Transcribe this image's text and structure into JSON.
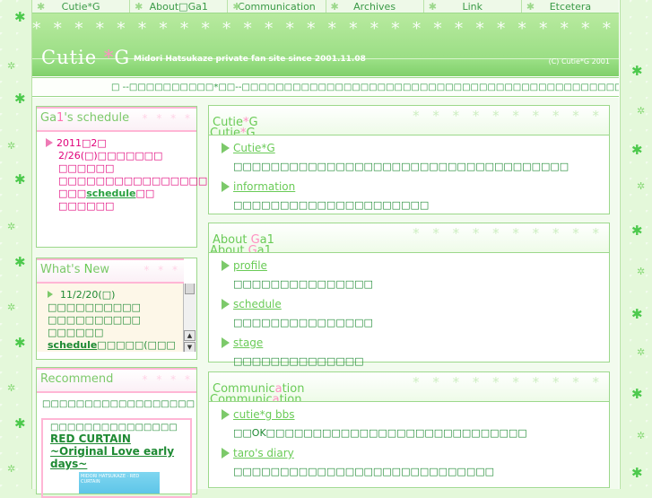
{
  "nav": {
    "items": [
      "Cutie*G",
      "About□Ga1",
      "Communication",
      "Archives",
      "Link",
      "Etcetera"
    ]
  },
  "banner": {
    "logo_main": "Cutie ",
    "logo_star": "*",
    "logo_end": "G",
    "tagline": "Midori Hatsukaze private fan site since 2001.11.08",
    "copyright": "(C) Cutie*G 2001",
    "stars": "* * * * * * * * * * * * * * * * * * * * * * * * * * * * * * * * * * * * * * * * *"
  },
  "marquee": {
    "text": "□ --□□□□□□□□□□*□□--□□□□□□□□□□□□□□□□□□□□□□□□□□□□□□□□□□□□□□□□□□□□□□□□□□□□□□□□□□□□□□□□□□**"
  },
  "schedule": {
    "title_pre": "Ga",
    "title_mid": "1",
    "title_post": "'s schedule",
    "date": "2011□2□",
    "line1": "2/26(□)□□□□□□□",
    "line2": "□□□□□□",
    "line3": "□□□□□□□□□□□□□□□□□□□",
    "line4_pre": "□□□",
    "line4_link": "schedule",
    "line4_post": "□□",
    "line5": "□□□□□□"
  },
  "whats_new": {
    "title_pre": "What's ",
    "title_n": "N",
    "title_post": "ew",
    "date": "11/2/20(□)",
    "line1": "□□□□□□□□□□",
    "line2": "□□□□□□□□□□",
    "line3": "□□□□□□",
    "line4_link": "schedule",
    "line4_post": "□□□□□(□□□"
  },
  "recommend": {
    "title_pre": "Re",
    "title_c": "c",
    "title_post": "ommend",
    "intro": "□□□□□□□□□□□□□□□□□□",
    "card_jp": "□□□□□□□□□□□□□□□",
    "card_link": "RED CURTAIN ~Original Love early days~",
    "album_caption": "MIDORI HATSUKAZE · RED CURTAIN"
  },
  "panel_cutie": {
    "title1_pre": "Cutie",
    "title1_star": "*",
    "title1_post": "G",
    "title2_pre": "Cutie",
    "title2_star": "*",
    "title2_post": "G",
    "item1": "Cutie*G",
    "desc1": "□□□□□□□□□□□□□□□□□□□□□□□□□□□□□□□□□□□□",
    "item2": "information",
    "desc2": "□□□□□□□□□□□□□□□□□□□□□"
  },
  "panel_about": {
    "title1_pre": "About ",
    "title1_pink": "G",
    "title1_post": "a1",
    "title2_pre": "About ",
    "title2_pink": "G",
    "title2_post": "a1",
    "item1": "profile",
    "desc1": "□□□□□□□□□□□□□□□",
    "item2": "schedule",
    "desc2": "□□□□□□□□□□□□□□□",
    "item3": "stage",
    "desc3": "□□□□□□□□□□□□□□"
  },
  "panel_comm": {
    "title1_pre": "Communic",
    "title1_pink": "a",
    "title1_post": "tion",
    "title2_pre": "Communic",
    "title2_pink": "a",
    "title2_post": "tion",
    "item1": "cutie*g bbs",
    "desc1": "□□OK□□□□□□□□□□□□□□□□□□□□□□□□□□□□",
    "item2": "taro's diary",
    "desc2": "□□□□□□□□□□□□□□□□□□□□□□□□□□□□"
  },
  "colors": {
    "accent_green": "#6acb57",
    "accent_pink": "#ff8fc2",
    "text_green": "#1e8a33",
    "schedule_pink": "#e0007a"
  }
}
